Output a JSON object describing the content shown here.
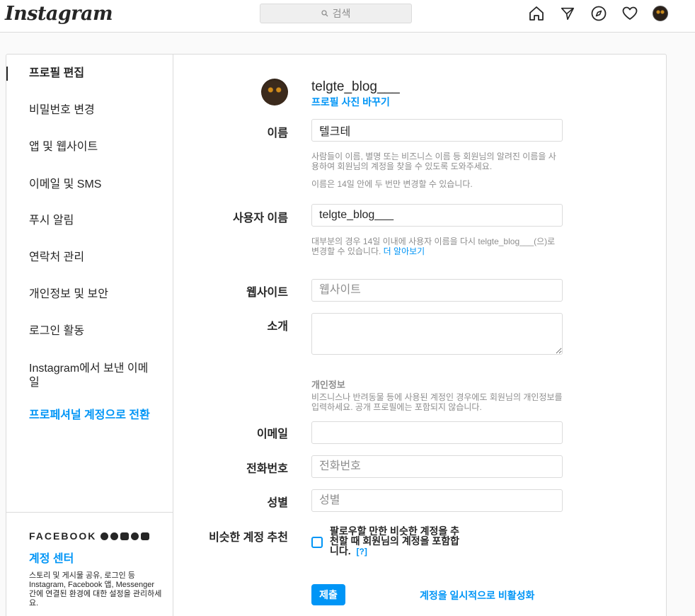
{
  "topbar": {
    "logo": "Instagram",
    "search_placeholder": "검색",
    "icons": [
      "home-icon",
      "paper-plane-icon",
      "compass-icon",
      "heart-icon",
      "avatar"
    ]
  },
  "sidebar": {
    "items": [
      {
        "label": "프로필 편집"
      },
      {
        "label": "비밀번호 변경"
      },
      {
        "label": "앱 및 웹사이트"
      },
      {
        "label": "이메일 및 SMS"
      },
      {
        "label": "푸시 알림"
      },
      {
        "label": "연락처 관리"
      },
      {
        "label": "개인정보 및 보안"
      },
      {
        "label": "로그인 활동"
      },
      {
        "label": "Instagram에서 보낸 이메일"
      },
      {
        "label": "프로페셔널 계정으로 전환"
      }
    ],
    "facebook": {
      "title": "FACEBOOK",
      "link": "계정 센터",
      "description": "스토리 및 게시물 공유, 로그인 등 Instagram, Facebook 앱, Messenger 간에 연결된 환경에 대한 설정을 관리하세요."
    }
  },
  "profile": {
    "username": "telgte_blog___",
    "change_photo": "프로필 사진 바꾸기"
  },
  "form": {
    "name_label": "이름",
    "name_value": "텔크테",
    "name_help_1": "사람들이 이름, 별명 또는 비즈니스 이름 등 회원님의 알려진 이름을 사용하여 회원님의 계정을 찾을 수 있도록 도와주세요.",
    "name_help_2": "이름은 14일 안에 두 번만 변경할 수 있습니다.",
    "username_label": "사용자 이름",
    "username_value": "telgte_blog___",
    "username_help": "대부분의 경우 14일 이내에 사용자 이름을 다시 telgte_blog___(으)로 변경할 수 있습니다.",
    "username_help_link": "더 알아보기",
    "website_label": "웹사이트",
    "website_placeholder": "웹사이트",
    "bio_label": "소개",
    "private_title": "개인정보",
    "private_help": "비즈니스나 반려동물 등에 사용된 계정인 경우에도 회원님의 개인정보를 입력하세요. 공개 프로필에는 포함되지 않습니다.",
    "email_label": "이메일",
    "email_value": "",
    "phone_label": "전화번호",
    "phone_placeholder": "전화번호",
    "gender_label": "성별",
    "gender_placeholder": "성별",
    "similar_label": "비슷한 계정 추천",
    "similar_text": "팔로우할 만한 비슷한 계정을 추천할 때 회원님의 계정을 포함합니다.",
    "similar_help_link": "[?]",
    "submit": "제출",
    "deactivate": "계정을 일시적으로 비활성화"
  },
  "colors": {
    "accent": "#0095f6",
    "border": "#dbdbdb",
    "text": "#262626",
    "muted": "#8e8e8e"
  }
}
